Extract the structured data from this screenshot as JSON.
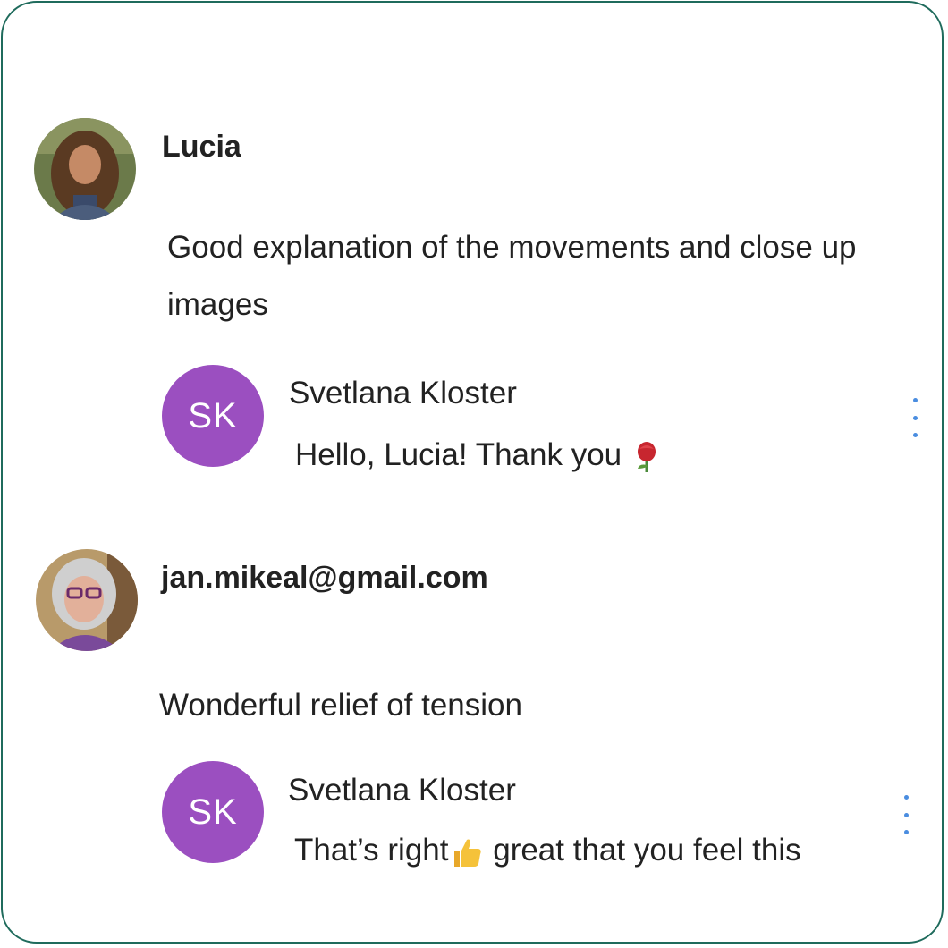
{
  "comments": [
    {
      "author": "Lucia",
      "text": "Good explanation of the movements and close up images",
      "reply": {
        "initials": "SK",
        "name": "Svetlana Kloster",
        "text": "Hello, Lucia! Thank you",
        "emoji": "rose-icon"
      }
    },
    {
      "author": "jan.mikeal@gmail.com",
      "text": "Wonderful relief of tension",
      "reply": {
        "initials": "SK",
        "name": "Svetlana Kloster",
        "text_before": "That’s right",
        "emoji": "thumbs-up-icon",
        "text_after": " great that you feel this"
      }
    }
  ],
  "colors": {
    "frame_border": "#1f6b5c",
    "reply_avatar": "#9b4fc0",
    "menu_dots": "#4a8de0"
  }
}
